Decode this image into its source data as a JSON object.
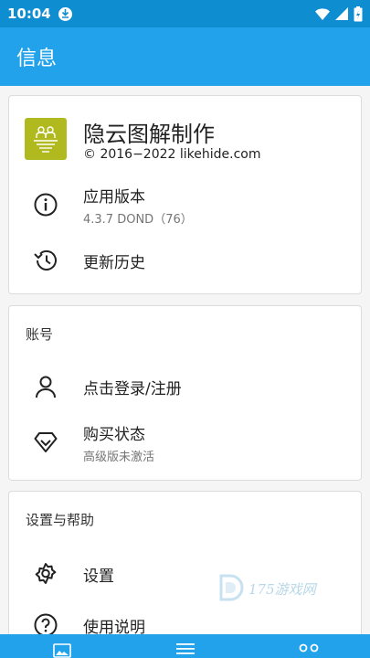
{
  "status_bar": {
    "time": "10:04"
  },
  "app_bar": {
    "title": "信息"
  },
  "about": {
    "app_name": "隐云图解制作",
    "copyright": "© 2016−2022 likehide.com",
    "version_label": "应用版本",
    "version_value": "4.3.7 DOND（76）",
    "history_label": "更新历史"
  },
  "account": {
    "section_title": "账号",
    "login_label": "点击登录/注册",
    "purchase_label": "购买状态",
    "purchase_status": "高级版未激活"
  },
  "help": {
    "section_title": "设置与帮助",
    "settings_label": "设置",
    "manual_label": "使用说明"
  },
  "watermark": {
    "text": "175游戏网"
  },
  "colors": {
    "status_bar": "#0e8ed1",
    "app_bar": "#22a2ea",
    "logo_bg": "#b0b91e"
  },
  "bottom_nav": {
    "tabs": [
      "image-icon",
      "menu-icon",
      "more-icon"
    ]
  }
}
